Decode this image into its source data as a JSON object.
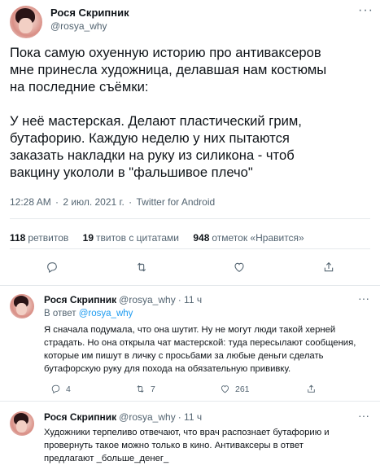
{
  "tweet": {
    "author_name": "Рося Скрипник",
    "author_handle": "@rosya_why",
    "more": "···",
    "text_lines": [
      "Пока самую охуенную историю про антиваксеров",
      "мне принесла художница, делавшая нам костюмы",
      "на последние съёмки:",
      "",
      "У неё мастерская. Делают пластический грим,",
      "бутафорию. Каждую неделю у них пытаются",
      "заказать накладки на руку из силикона - чтоб",
      "вакцину укололи в \"фальшивое плечо\""
    ],
    "time": "12:28 AM",
    "date": "2 июл. 2021 г.",
    "source": "Twitter for Android",
    "sep": "·"
  },
  "stats": {
    "retweets_count": "118",
    "retweets_label": "ретвитов",
    "quotes_count": "19",
    "quotes_label": "твитов с цитатами",
    "likes_count": "948",
    "likes_label": "отметок «Нравится»"
  },
  "actions": {
    "icons": [
      "reply-icon",
      "retweet-icon",
      "like-icon",
      "share-icon"
    ]
  },
  "replies": [
    {
      "author_name": "Рося Скрипник",
      "author_handle": "@rosya_why",
      "time": "· 11 ч",
      "more": "···",
      "reply_to_prefix": "В ответ",
      "reply_to_handle": "@rosya_why",
      "text_lines": [
        "Я сначала подумала, что она шутит. Ну не могут люди такой херней",
        "страдать. Но она открыла чат мастерской: туда пересылают сообщения,",
        "которые им пишут в личку с просьбами за любые деньги сделать",
        "бутафорскую руку для похода на обязательную прививку."
      ],
      "reply_count": "4",
      "retweet_count": "7",
      "like_count": "261"
    },
    {
      "author_name": "Рося Скрипник",
      "author_handle": "@rosya_why",
      "time": "· 11 ч",
      "more": "···",
      "text_lines": [
        "Художники терпеливо отвечают, что врач распознает бутафорию и",
        "провернуть такое можно только  в кино. Антиваксеры в ответ",
        "предлагают _больше_денег_"
      ]
    }
  ],
  "colors": {
    "text": "#0f1419",
    "muted": "#536471",
    "link": "#1d9bf0",
    "divider": "#e5e9ec"
  }
}
